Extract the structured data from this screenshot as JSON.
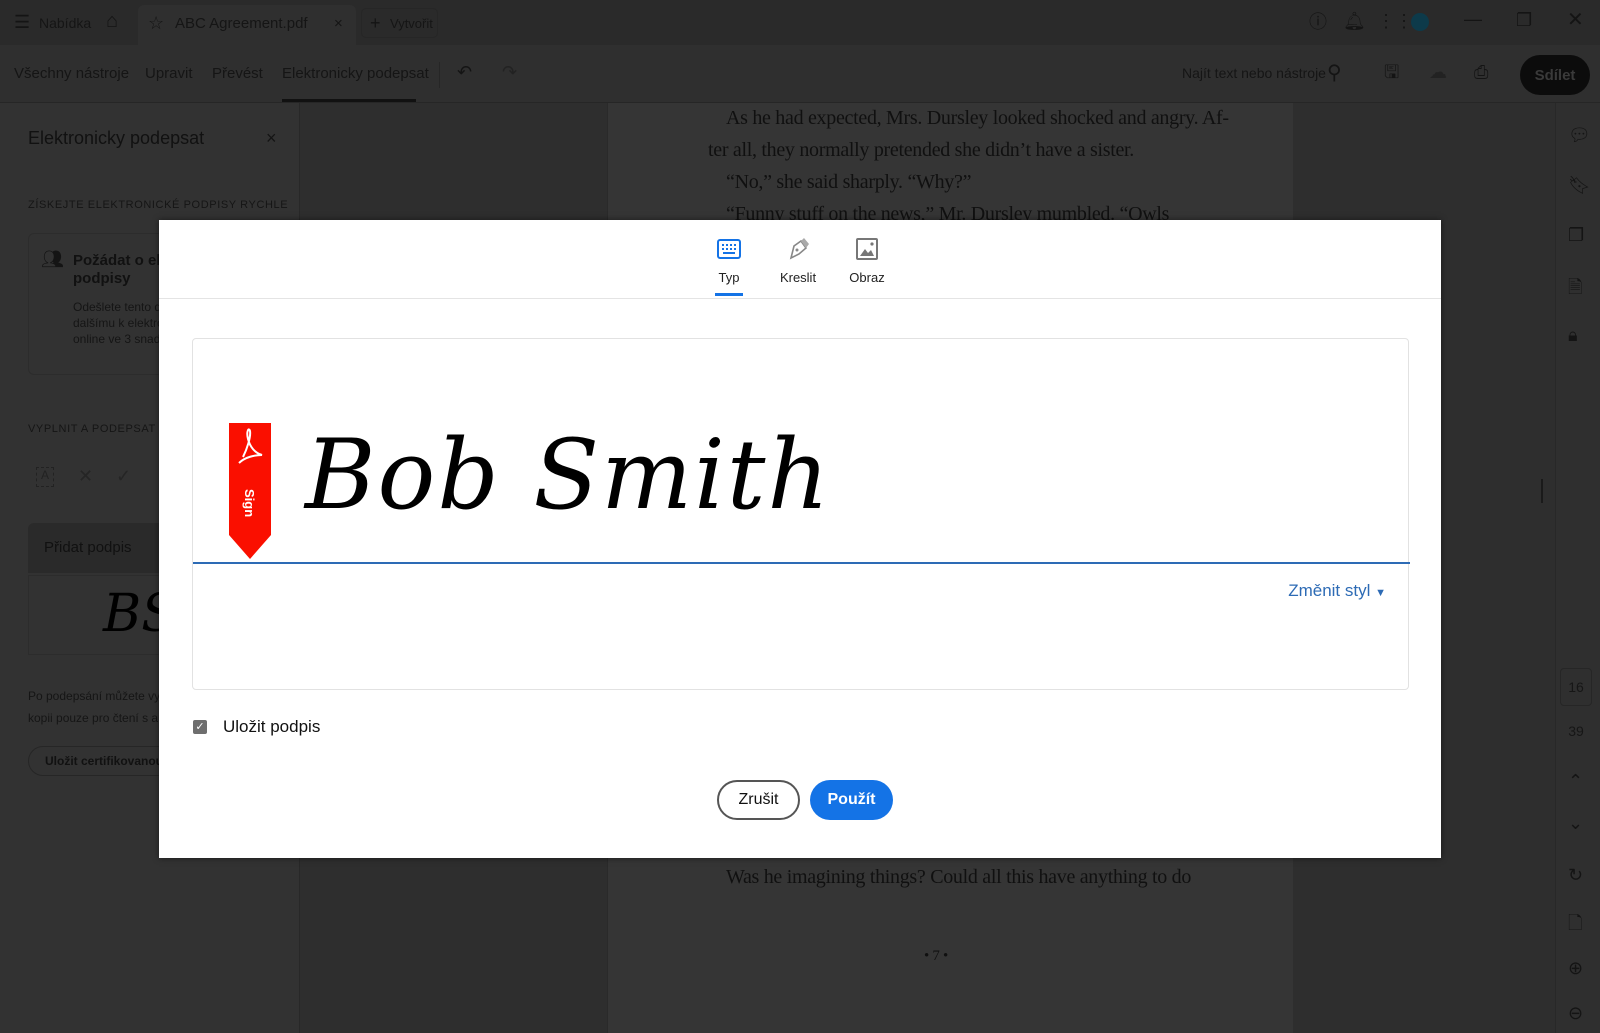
{
  "tabbar": {
    "menu_label": "Nabídka",
    "doc_tab": "ABC Agreement.pdf",
    "new_label": "Vytvořit"
  },
  "toolbar": {
    "tools": [
      "Všechny nástroje",
      "Upravit",
      "Převést",
      "Elektronicky podepsat"
    ],
    "search_placeholder": "Najít text nebo nástroje",
    "share_label": "Sdílet"
  },
  "panel": {
    "title": "Elektronicky podepsat",
    "section1": "ZÍSKEJTE ELEKTRONICKÉ PODPISY RYCHLE",
    "card_title1": "Požádat o ele",
    "card_title2": "podpisy",
    "card_desc": [
      "Odešlete tento d",
      "dalšímu k elektro",
      "online ve 3 snadn"
    ],
    "section2": "VYPLNIT A PODEPSAT SA",
    "add_signature": "Přidat podpis",
    "saved_initials": "BS",
    "footer_text": [
      "Po podepsání můžete vyt",
      "kopii pouze pro čtení s au"
    ],
    "certify_button": "Uložit certifikovanou"
  },
  "document": {
    "lines": [
      "As he had expected, Mrs. Dursley looked shocked and angry. Af-",
      "ter all, they normally pretended she didn’t have a sister.",
      "“No,” she said sharply. “Why?”",
      "“Funny stuff on the news,” Mr. Dursley mumbled. “Owls"
    ],
    "bottom_line": "Was he imagining things? Could all this have anything to do",
    "page_footer": "• 7 •"
  },
  "rail": {
    "current_page": "16",
    "total_pages": "39"
  },
  "dialog": {
    "tabs": [
      "Typ",
      "Kreslit",
      "Obraz"
    ],
    "active_tab": "Typ",
    "signature_text": "Bob Smith",
    "sign_tag": "Sign",
    "change_style": "Změnit styl",
    "save_signature_label": "Uložit podpis",
    "save_signature_checked": true,
    "cancel": "Zrušit",
    "apply": "Použít"
  },
  "colors": {
    "accent": "#1473e6",
    "sign_red": "#fa0f00",
    "link": "#2d6bb5"
  }
}
